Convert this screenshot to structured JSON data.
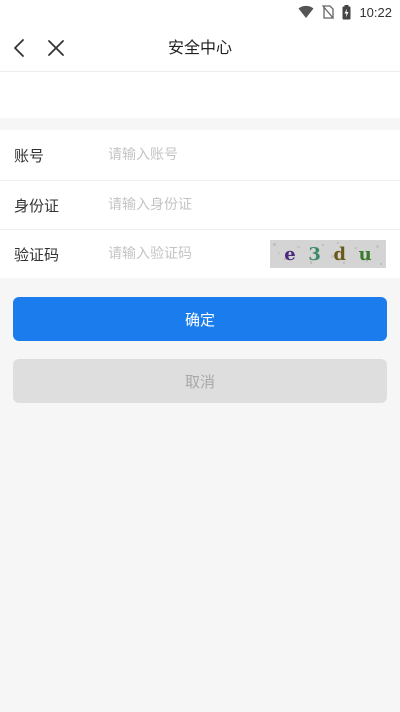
{
  "status_bar": {
    "time": "10:22",
    "icons": [
      "wifi-icon",
      "no-sim-icon",
      "battery-charging-icon"
    ]
  },
  "header": {
    "title": "安全中心",
    "back_icon": "chevron-left-icon",
    "close_icon": "close-icon"
  },
  "form": {
    "account": {
      "label": "账号",
      "placeholder": "请输入账号",
      "value": ""
    },
    "id_card": {
      "label": "身份证",
      "placeholder": "请输入身份证",
      "value": ""
    },
    "captcha": {
      "label": "验证码",
      "placeholder": "请输入验证码",
      "value": "",
      "image_chars": [
        {
          "char": "e",
          "color": "#4a2a7a"
        },
        {
          "char": "3",
          "color": "#3d8a6a"
        },
        {
          "char": "d",
          "color": "#6a5a1a"
        },
        {
          "char": "u",
          "color": "#3a7a2a"
        }
      ]
    }
  },
  "actions": {
    "confirm_label": "确定",
    "cancel_label": "取消"
  },
  "colors": {
    "primary": "#1b7ded",
    "disabled": "#dedede",
    "background": "#f6f6f6"
  }
}
